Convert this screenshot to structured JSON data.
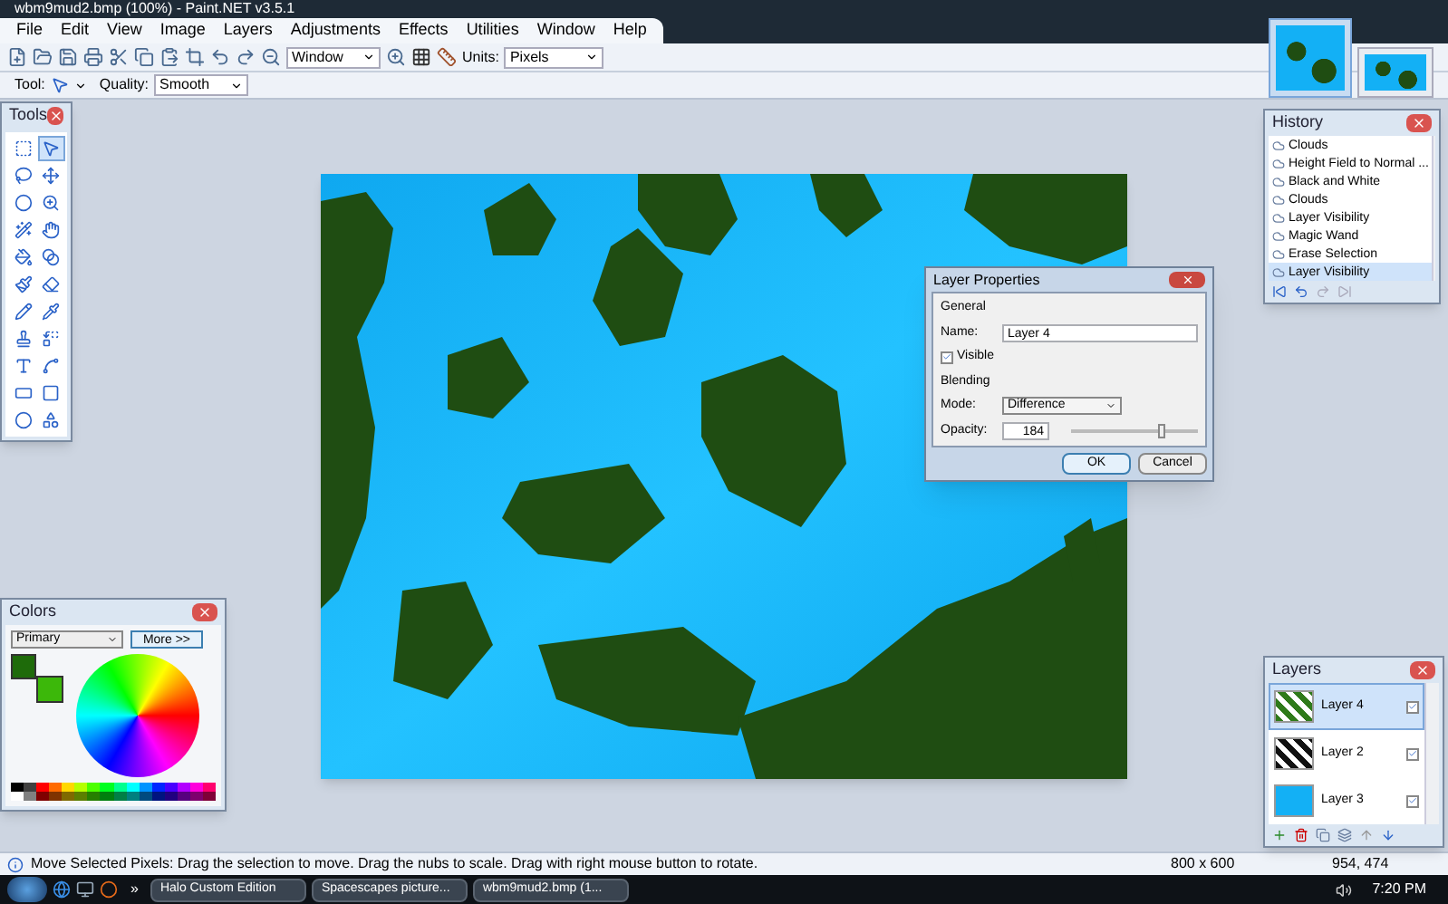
{
  "window": {
    "title": "wbm9mud2.bmp (100%) - Paint.NET v3.5.1"
  },
  "menu": [
    "File",
    "Edit",
    "View",
    "Image",
    "Layers",
    "Adjustments",
    "Effects",
    "Utilities",
    "Window",
    "Help"
  ],
  "toolbar": {
    "zoom": "Window",
    "units_label": "Units:",
    "units": "Pixels",
    "tool_label": "Tool:",
    "quality_label": "Quality:",
    "quality": "Smooth"
  },
  "documents": [
    {
      "selected": true
    },
    {
      "selected": false
    }
  ],
  "tools_panel": {
    "title": "Tools",
    "tools": [
      {
        "selected": false
      },
      {
        "selected": true
      },
      {
        "selected": false
      },
      {
        "selected": false
      },
      {
        "selected": false
      },
      {
        "selected": false
      },
      {
        "selected": false
      },
      {
        "selected": false
      },
      {
        "selected": false
      },
      {
        "selected": false
      },
      {
        "selected": false
      },
      {
        "selected": false
      },
      {
        "selected": false
      },
      {
        "selected": false
      },
      {
        "selected": false
      },
      {
        "selected": false
      },
      {
        "selected": false
      },
      {
        "selected": false
      },
      {
        "selected": false
      },
      {
        "selected": false
      },
      {
        "selected": false
      },
      {
        "selected": false
      }
    ]
  },
  "history_panel": {
    "title": "History",
    "items": [
      {
        "label": "Clouds",
        "selected": false
      },
      {
        "label": "Height Field to Normal ...",
        "selected": false
      },
      {
        "label": "Black and White",
        "selected": false
      },
      {
        "label": "Clouds",
        "selected": false
      },
      {
        "label": "Layer Visibility",
        "selected": false
      },
      {
        "label": "Magic Wand",
        "selected": false
      },
      {
        "label": "Erase Selection",
        "selected": false
      },
      {
        "label": "Layer Visibility",
        "selected": true
      }
    ]
  },
  "dialog": {
    "title": "Layer Properties",
    "general": "General",
    "name_label": "Name:",
    "name": "Layer 4",
    "visible_label": "Visible",
    "visible": true,
    "blending": "Blending",
    "mode_label": "Mode:",
    "mode": "Difference",
    "opacity_label": "Opacity:",
    "opacity": "184",
    "opacity_slider": {
      "level": 0.72
    },
    "buttons": [
      "OK",
      "Cancel"
    ]
  },
  "colors_panel": {
    "title": "Colors",
    "target": "Primary",
    "more": "More >>",
    "primary": {
      "color": "#1e6b0a"
    },
    "secondary": {
      "color": "#3cb80a"
    },
    "palette": [
      {
        "color": "#000000"
      },
      {
        "color": "#404040"
      },
      {
        "color": "#ff0000"
      },
      {
        "color": "#ff6a00"
      },
      {
        "color": "#ffd800"
      },
      {
        "color": "#b6ff00"
      },
      {
        "color": "#4cff00"
      },
      {
        "color": "#00ff21"
      },
      {
        "color": "#00ff90"
      },
      {
        "color": "#00ffff"
      },
      {
        "color": "#0094ff"
      },
      {
        "color": "#0026ff"
      },
      {
        "color": "#4800ff"
      },
      {
        "color": "#b200ff"
      },
      {
        "color": "#ff00dc"
      },
      {
        "color": "#ff006e"
      },
      {
        "color": "#ffffff"
      },
      {
        "color": "#808080"
      },
      {
        "color": "#7f0000"
      },
      {
        "color": "#7f3300"
      },
      {
        "color": "#7f6a00"
      },
      {
        "color": "#5b7f00"
      },
      {
        "color": "#267f00"
      },
      {
        "color": "#007f0e"
      },
      {
        "color": "#007f46"
      },
      {
        "color": "#007f7f"
      },
      {
        "color": "#004a7f"
      },
      {
        "color": "#00137f"
      },
      {
        "color": "#21007f"
      },
      {
        "color": "#57007f"
      },
      {
        "color": "#7f006e"
      },
      {
        "color": "#7f0037"
      }
    ]
  },
  "layers_panel": {
    "title": "Layers",
    "layers": [
      {
        "name": "Layer 4",
        "kind": "mixed",
        "visible": true,
        "selected": true
      },
      {
        "name": "Layer 2",
        "kind": "mono",
        "visible": true,
        "selected": false
      },
      {
        "name": "Layer 3",
        "kind": "blue",
        "visible": true,
        "selected": false
      }
    ]
  },
  "status_bar": {
    "message": "Move Selected Pixels: Drag the selection to move. Drag the nubs to scale. Drag with right mouse button to rotate.",
    "size": "800 x 600",
    "cursor": "954, 474"
  },
  "taskbar": {
    "more": "»",
    "buttons": [
      "Halo Custom Edition",
      "Spacescapes picture...",
      "wbm9mud2.bmp (1..."
    ],
    "clock": "7:20 PM"
  }
}
